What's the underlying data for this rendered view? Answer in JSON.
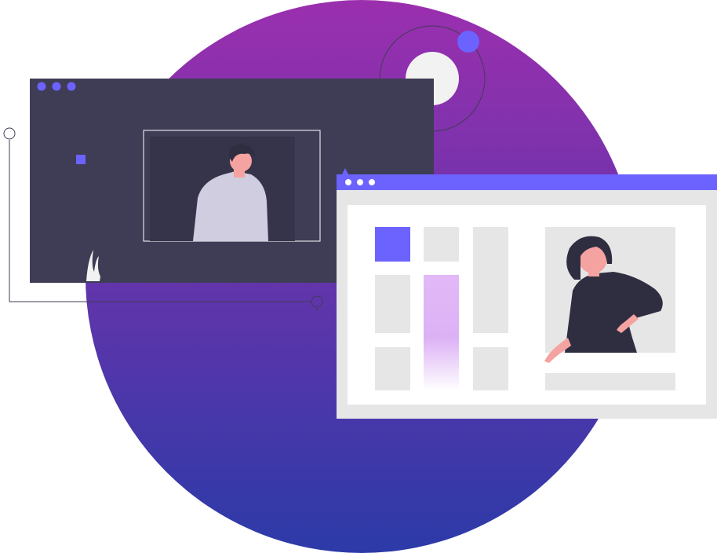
{
  "illustration": {
    "colors": {
      "circle_top": "#9b2fae",
      "circle_bottom": "#2c3aa8",
      "dark_window": "#3f3d56",
      "accent": "#6c63ff",
      "light_window_frame": "#e6e6e6",
      "light_window_body": "#ffffff",
      "placeholder_block": "#e6e6e6",
      "gradient_bar": "#d9a8f5",
      "person_skin": "#f5a3a0",
      "person_dark": "#2f2e41",
      "person_sweater": "#d0cde1",
      "orbit_line": "#3f3d56"
    },
    "icons": [
      "window-dots-icon",
      "orbit-planet-icon",
      "grass-icon",
      "connector-line-icon",
      "man-avatar-icon",
      "woman-avatar-icon"
    ]
  }
}
